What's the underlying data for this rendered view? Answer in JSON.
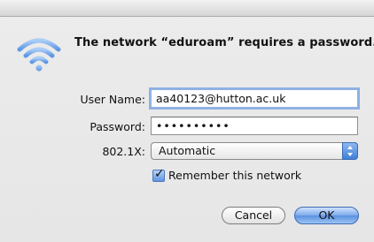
{
  "dialog": {
    "title": "The network “eduroam” requires a password."
  },
  "form": {
    "username_label": "User Name:",
    "username_value": "aa40123@hutton.ac.uk",
    "password_label": "Password:",
    "password_value": "••••••••••",
    "eap_label": "802.1X:",
    "eap_selected": "Automatic",
    "remember_label": "Remember this network",
    "remember_checked": true
  },
  "buttons": {
    "cancel": "Cancel",
    "ok": "OK"
  },
  "icons": {
    "network": "wifi-icon",
    "checkbox": "checkmark-icon",
    "select": "updown-arrows-icon"
  },
  "colors": {
    "accent": "#5a90e0",
    "wifi": "#86b4ef"
  }
}
